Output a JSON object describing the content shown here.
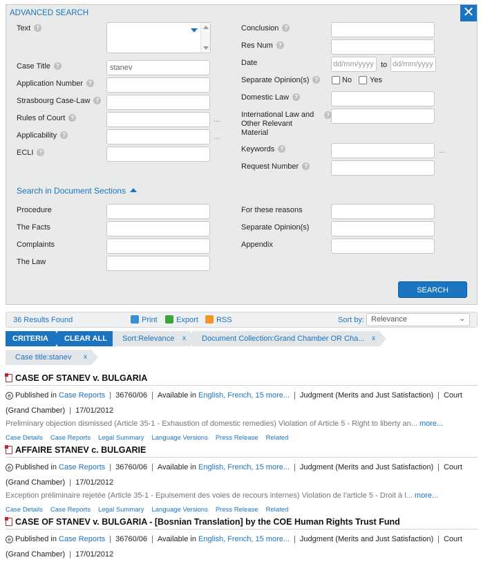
{
  "panel": {
    "title": "ADVANCED SEARCH",
    "close": "✕",
    "left_fields": [
      {
        "label": "Text",
        "value": ""
      },
      {
        "label": "Case Title",
        "value": "stanev"
      },
      {
        "label": "Application Number",
        "value": ""
      },
      {
        "label": "Strasbourg Case-Law",
        "value": ""
      },
      {
        "label": "Rules of Court",
        "value": ""
      },
      {
        "label": "Applicability",
        "value": ""
      },
      {
        "label": "ECLI",
        "value": ""
      }
    ],
    "right_fields": [
      {
        "label": "Conclusion",
        "value": ""
      },
      {
        "label": "Res Num",
        "value": ""
      },
      {
        "label": "Date",
        "from_placeholder": "dd/mm/yyyy",
        "to_label": "to",
        "to_placeholder": "dd/mm/yyyy"
      },
      {
        "label": "Separate Opinion(s)",
        "no": "No",
        "yes": "Yes"
      },
      {
        "label": "Domestic Law",
        "value": ""
      },
      {
        "label": "International Law and Other Relevant Material",
        "value": ""
      },
      {
        "label": "Keywords",
        "value": ""
      },
      {
        "label": "Request Number",
        "value": ""
      }
    ],
    "ellipsis": "...",
    "sections_toggle": "Search in Document Sections",
    "section_left": [
      "Procedure",
      "The Facts",
      "Complaints",
      "The Law"
    ],
    "section_right": [
      "For these reasons",
      "Separate Opinion(s)",
      "Appendix"
    ],
    "search_button": "SEARCH"
  },
  "toolbar": {
    "results": "36 Results Found",
    "print": "Print",
    "export": "Export",
    "rss": "RSS",
    "sort_label": "Sort by:",
    "sort_value": "Relevance"
  },
  "criteria": {
    "criteria": "CRITERIA",
    "clear_all": "CLEAR ALL",
    "chips": [
      "Sort:Relevance",
      "Document Collection:Grand Chamber OR Cha...",
      "Case title:stanev"
    ],
    "remove": "x"
  },
  "results": [
    {
      "title": "CASE OF STANEV v. BULGARIA",
      "published_in_label": "Published in",
      "published_in_link": "Case Reports",
      "app_no": "36760/06",
      "available_label": "Available in",
      "languages": "English, French, 15 more...",
      "judgment": "Judgment (Merits and Just Satisfaction)",
      "court": "Court (Grand Chamber)",
      "date": "17/01/2012",
      "snippet": "Preliminary objection dismissed (Article 35-1 - Exhaustion of domestic remedies) Violation of Article 5 - Right to liberty an...",
      "more": "more...",
      "links": [
        "Case Details",
        "Case Reports",
        "Legal Summary",
        "Language Versions",
        "Press Release",
        "Related"
      ]
    },
    {
      "title": "AFFAIRE STANEV c. BULGARIE",
      "published_in_label": "Published in",
      "published_in_link": "Case Reports",
      "app_no": "36760/06",
      "available_label": "Available in",
      "languages": "English, French, 15 more...",
      "judgment": "Judgment (Merits and Just Satisfaction)",
      "court": "Court (Grand Chamber)",
      "date": "17/01/2012",
      "snippet": "Exception préliminaire rejetée (Article 35-1 - Epuisement des voies de recours internes) Violation de l'article 5 - Droit à l...",
      "more": "more...",
      "links": [
        "Case Details",
        "Case Reports",
        "Legal Summary",
        "Language Versions",
        "Press Release",
        "Related"
      ]
    },
    {
      "title": "CASE OF STANEV v. BULGARIA - [Bosnian Translation] by the COE Human Rights Trust Fund",
      "published_in_label": "Published in",
      "published_in_link": "Case Reports",
      "app_no": "36760/06",
      "available_label": "Available in",
      "languages": "English, French, 15 more...",
      "judgment": "Judgment (Merits and Just Satisfaction)",
      "court": "Court (Grand Chamber)",
      "date": "17/01/2012"
    }
  ]
}
